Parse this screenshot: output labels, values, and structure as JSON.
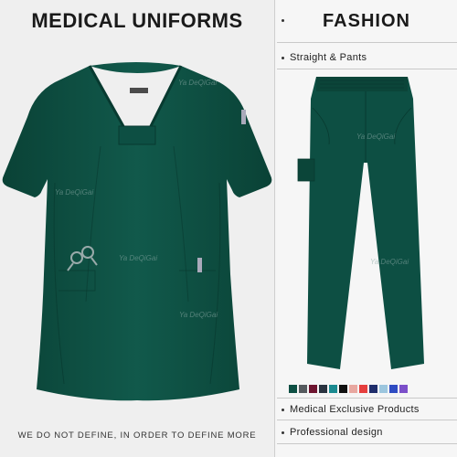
{
  "header": {
    "left_title": "MEDICAL UNIFORMS",
    "right_title": "FASHION"
  },
  "features": [
    {
      "label": "Straight & Pants"
    },
    {
      "label": "Medical Exclusive Products"
    },
    {
      "label": "Professional design"
    }
  ],
  "footer": {
    "slogan": "WE DO NOT DEFINE, IN ORDER TO DEFINE MORE"
  },
  "watermark": "Ya DeQiGai",
  "colors": {
    "garment": "#0d4f43",
    "garment_dark": "#093b32",
    "garment_light": "#14604f"
  },
  "swatches": [
    "#0d4f43",
    "#555a5e",
    "#6e1530",
    "#2a3340",
    "#1b8a90",
    "#111111",
    "#e8a7a0",
    "#e53e3e",
    "#1f2d6b",
    "#9cc6de",
    "#2f4cc2",
    "#7b4fc9"
  ]
}
